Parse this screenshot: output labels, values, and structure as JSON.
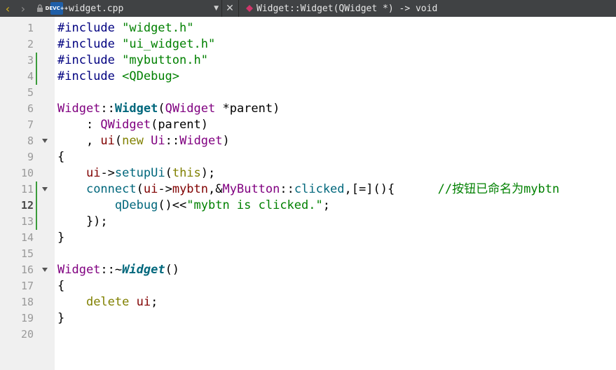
{
  "toolbar": {
    "file_name": "widget.cpp",
    "func_name": "Widget::Widget(QWidget *) -> void",
    "dev_icon_top": "DEV",
    "dev_icon_bottom": "C++",
    "close_glyph": "✕",
    "colors": {
      "toolbar_bg": "#404244",
      "symbol": "#d0356a",
      "back_arrow": "#d7b11a"
    }
  },
  "editor": {
    "line_numbers": [
      "1",
      "2",
      "3",
      "4",
      "5",
      "6",
      "7",
      "8",
      "9",
      "10",
      "11",
      "12",
      "13",
      "14",
      "15",
      "16",
      "17",
      "18",
      "19",
      "20"
    ],
    "current_line": "12",
    "lines": [
      [
        [
          "pre",
          "#include "
        ],
        [
          "str",
          "\"widget.h\""
        ]
      ],
      [
        [
          "pre",
          "#include "
        ],
        [
          "str",
          "\"ui_widget.h\""
        ]
      ],
      [
        [
          "pre",
          "#include "
        ],
        [
          "str",
          "\"mybutton.h\""
        ]
      ],
      [
        [
          "pre",
          "#include "
        ],
        [
          "str",
          "<QDebug>"
        ]
      ],
      [],
      [
        [
          "type",
          "Widget"
        ],
        [
          "plain",
          "::"
        ],
        [
          "func",
          "Widget"
        ],
        [
          "plain",
          "("
        ],
        [
          "type",
          "QWidget"
        ],
        [
          "plain",
          " *parent)"
        ]
      ],
      [
        [
          "plain",
          "    : "
        ],
        [
          "type",
          "QWidget"
        ],
        [
          "plain",
          "(parent)"
        ]
      ],
      [
        [
          "plain",
          "    , "
        ],
        [
          "mem",
          "ui"
        ],
        [
          "plain",
          "("
        ],
        [
          "kw",
          "new"
        ],
        [
          "plain",
          " "
        ],
        [
          "type",
          "Ui"
        ],
        [
          "plain",
          "::"
        ],
        [
          "type",
          "Widget"
        ],
        [
          "plain",
          ")"
        ]
      ],
      [
        [
          "plain",
          "{"
        ]
      ],
      [
        [
          "plain",
          "    "
        ],
        [
          "mem",
          "ui"
        ],
        [
          "plain",
          "->"
        ],
        [
          "call",
          "setupUi"
        ],
        [
          "plain",
          "("
        ],
        [
          "kw",
          "this"
        ],
        [
          "plain",
          ");"
        ]
      ],
      [
        [
          "plain",
          "    "
        ],
        [
          "call",
          "connect"
        ],
        [
          "plain",
          "("
        ],
        [
          "mem",
          "ui"
        ],
        [
          "plain",
          "->"
        ],
        [
          "mem",
          "mybtn"
        ],
        [
          "plain",
          ",&"
        ],
        [
          "type",
          "MyButton"
        ],
        [
          "plain",
          "::"
        ],
        [
          "call",
          "clicked"
        ],
        [
          "plain",
          ",[=](){      "
        ],
        [
          "cmt",
          "//按钮已命名为mybtn"
        ]
      ],
      [
        [
          "plain",
          "        "
        ],
        [
          "call",
          "qDebug"
        ],
        [
          "plain",
          "()<<"
        ],
        [
          "str",
          "\"mybtn is clicked.\""
        ],
        [
          "plain",
          ";"
        ]
      ],
      [
        [
          "plain",
          "    });"
        ]
      ],
      [
        [
          "plain",
          "}"
        ]
      ],
      [],
      [
        [
          "type",
          "Widget"
        ],
        [
          "plain",
          "::~"
        ],
        [
          "funcital",
          "Widget"
        ],
        [
          "plain",
          "()"
        ]
      ],
      [
        [
          "plain",
          "{"
        ]
      ],
      [
        [
          "plain",
          "    "
        ],
        [
          "kw",
          "delete"
        ],
        [
          "plain",
          " "
        ],
        [
          "mem",
          "ui"
        ],
        [
          "plain",
          ";"
        ]
      ],
      [
        [
          "plain",
          "}"
        ]
      ],
      []
    ],
    "fold_lines": [
      "8",
      "11",
      "16"
    ],
    "changed_lines": [
      "3",
      "4",
      "11",
      "12",
      "13"
    ]
  }
}
